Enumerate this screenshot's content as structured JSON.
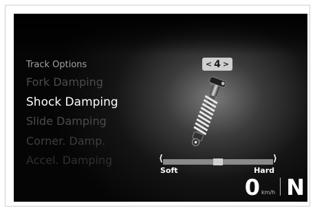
{
  "menu": {
    "header": "Track Options",
    "items": [
      {
        "label": "Fork Damping"
      },
      {
        "label": "Shock Damping"
      },
      {
        "label": "Slide Damping"
      },
      {
        "label": "Corner. Damp."
      },
      {
        "label": "Accel. Damping"
      }
    ],
    "selected": "Shock Damping"
  },
  "selector": {
    "value": "4",
    "left_arrow": "<",
    "right_arrow": ">"
  },
  "damping_scale": {
    "min_label": "Soft",
    "max_label": "Hard",
    "level_fraction": 0.5
  },
  "status": {
    "speed": "0",
    "speed_unit": "km/h",
    "gear": "N"
  },
  "icons": {
    "shock": "rear-shock-absorber-icon"
  },
  "colors": {
    "background": "#050505",
    "active_text": "#ffffff",
    "inactive_text": "#4c4c4c"
  }
}
